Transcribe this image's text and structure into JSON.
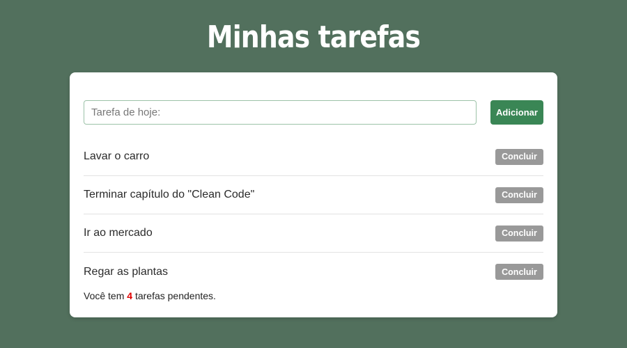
{
  "header": {
    "title": "Minhas tarefas"
  },
  "form": {
    "input_placeholder": "Tarefa de hoje:",
    "input_value": "",
    "add_label": "Adicionar"
  },
  "tasks": [
    {
      "label": "Lavar o carro",
      "action": "Concluir"
    },
    {
      "label": "Terminar capítulo do \"Clean Code\"",
      "action": "Concluir"
    },
    {
      "label": "Ir ao mercado",
      "action": "Concluir"
    },
    {
      "label": "Regar as plantas",
      "action": "Concluir"
    }
  ],
  "footer": {
    "prefix": "Você tem",
    "count": "4",
    "suffix": "tarefas pendentes."
  },
  "colors": {
    "background": "#52705d",
    "accent": "#3a8655",
    "count": "#e00000",
    "done_button": "#999999"
  }
}
